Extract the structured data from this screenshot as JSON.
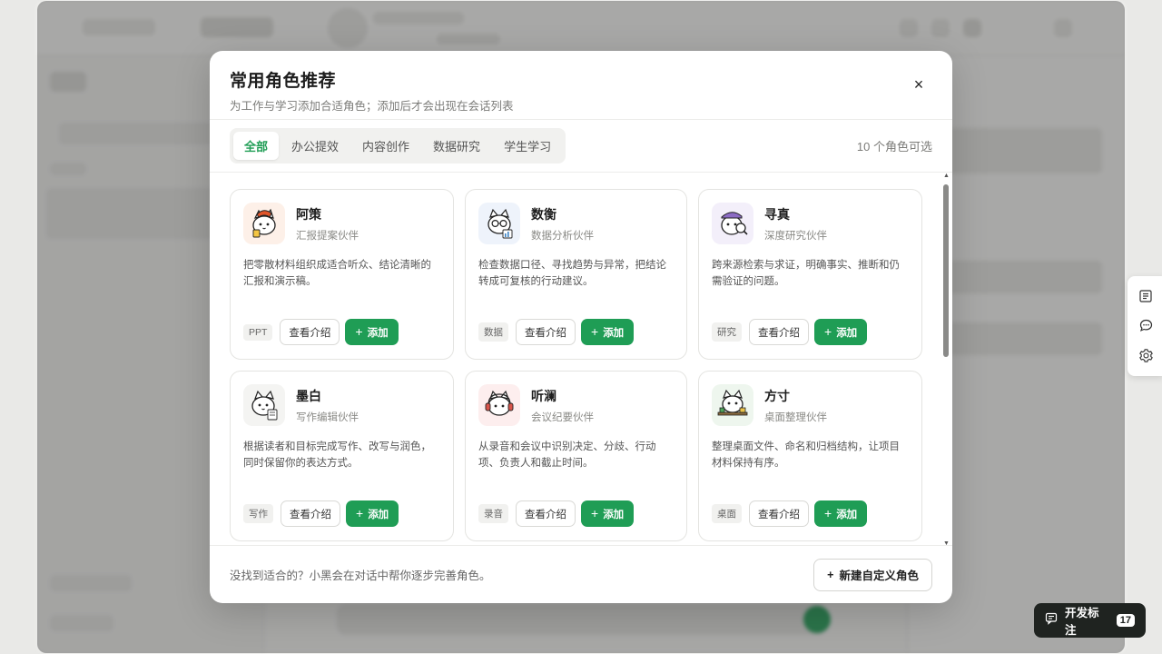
{
  "modal": {
    "title": "常用角色推荐",
    "subtitle": "为工作与学习添加合适角色；添加后才会出现在会话列表",
    "close_glyph": "×"
  },
  "tabs": [
    {
      "label": "全部",
      "active": true
    },
    {
      "label": "办公提效",
      "active": false
    },
    {
      "label": "内容创作",
      "active": false
    },
    {
      "label": "数据研究",
      "active": false
    },
    {
      "label": "学生学习",
      "active": false
    }
  ],
  "role_count": "10 个角色可选",
  "buttons": {
    "intro": "查看介绍",
    "add": "添加",
    "add_plus": "+"
  },
  "cards": [
    {
      "name": "阿策",
      "role": "汇报提案伙伴",
      "desc": "把零散材料组织成适合听众、结论清晰的汇报和演示稿。",
      "tag": "PPT",
      "accent": "#fdf0e8",
      "icon": "cat-fox-hat-icon"
    },
    {
      "name": "数衡",
      "role": "数据分析伙伴",
      "desc": "检查数据口径、寻找趋势与异常，把结论转成可复核的行动建议。",
      "tag": "数据",
      "accent": "#eef3fb",
      "icon": "cat-glasses-chart-icon"
    },
    {
      "name": "寻真",
      "role": "深度研究伙伴",
      "desc": "跨来源检索与求证，明确事实、推断和仍需验证的问题。",
      "tag": "研究",
      "accent": "#f3effa",
      "icon": "cat-detective-icon"
    },
    {
      "name": "墨白",
      "role": "写作编辑伙伴",
      "desc": "根据读者和目标完成写作、改写与润色，同时保留你的表达方式。",
      "tag": "写作",
      "accent": "#f4f4f2",
      "icon": "cat-writer-icon"
    },
    {
      "name": "听澜",
      "role": "会议纪要伙伴",
      "desc": "从录音和会议中识别决定、分歧、行动项、负责人和截止时间。",
      "tag": "录音",
      "accent": "#fdeeee",
      "icon": "cat-headphones-icon"
    },
    {
      "name": "方寸",
      "role": "桌面整理伙伴",
      "desc": "整理桌面文件、命名和归档结构，让项目材料保持有序。",
      "tag": "桌面",
      "accent": "#eef6ee",
      "icon": "cat-desk-icon"
    }
  ],
  "footer": {
    "text": "没找到适合的？小黑会在对话中帮你逐步完善角色。",
    "new_button": "新建自定义角色",
    "new_plus": "+"
  },
  "float_tools": [
    "document-icon",
    "chat-bubble-icon",
    "gear-icon"
  ],
  "dev_tag": {
    "label": "开发标注",
    "count": "17"
  },
  "colors": {
    "accent": "#1f9d55",
    "dev_bg": "#1f2320"
  }
}
